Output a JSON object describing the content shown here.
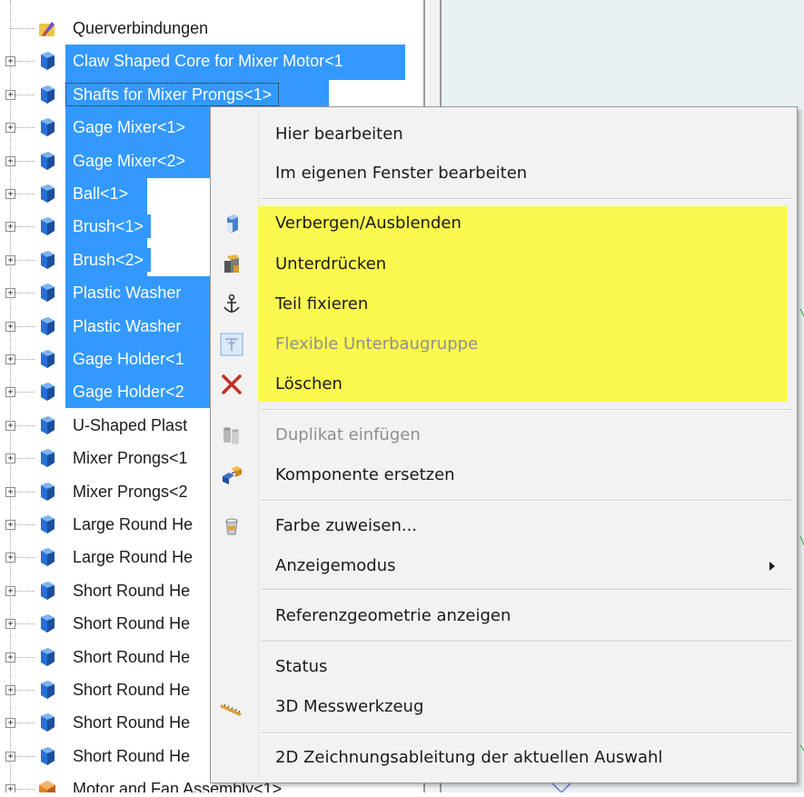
{
  "tree": {
    "items": [
      {
        "label": "Querverbindungen",
        "icon": "folder-connections-icon",
        "selected": false,
        "expandable": false
      },
      {
        "label": "Claw Shaped Core for Mixer Motor<1",
        "icon": "part-icon",
        "selected": true,
        "expandable": true
      },
      {
        "label": "Shafts for Mixer Prongs<1>",
        "icon": "part-icon",
        "selected": true,
        "focused": true,
        "expandable": true
      },
      {
        "label": "Gage Mixer<1>",
        "icon": "part-icon",
        "selected": true,
        "expandable": true
      },
      {
        "label": "Gage Mixer<2>",
        "icon": "part-icon",
        "selected": true,
        "expandable": true
      },
      {
        "label": "Ball<1>",
        "icon": "part-icon",
        "selected": true,
        "expandable": true
      },
      {
        "label": "Brush<1>",
        "icon": "part-icon",
        "selected": true,
        "expandable": true
      },
      {
        "label": "Brush<2>",
        "icon": "part-icon",
        "selected": true,
        "expandable": true
      },
      {
        "label": "Plastic Washer",
        "icon": "part-icon",
        "selected": true,
        "expandable": true
      },
      {
        "label": "Plastic Washer",
        "icon": "part-icon",
        "selected": true,
        "expandable": true
      },
      {
        "label": "Gage Holder<1",
        "icon": "part-icon",
        "selected": true,
        "expandable": true
      },
      {
        "label": "Gage Holder<2",
        "icon": "part-icon",
        "selected": true,
        "expandable": true
      },
      {
        "label": "U-Shaped Plast",
        "icon": "part-icon",
        "selected": false,
        "expandable": true
      },
      {
        "label": "Mixer Prongs<1",
        "icon": "part-icon",
        "selected": false,
        "expandable": true
      },
      {
        "label": "Mixer Prongs<2",
        "icon": "part-icon",
        "selected": false,
        "expandable": true
      },
      {
        "label": "Large Round He",
        "icon": "part-icon",
        "selected": false,
        "expandable": true
      },
      {
        "label": "Large Round He",
        "icon": "part-icon",
        "selected": false,
        "expandable": true
      },
      {
        "label": "Short Round He",
        "icon": "part-icon",
        "selected": false,
        "expandable": true
      },
      {
        "label": "Short Round He",
        "icon": "part-icon",
        "selected": false,
        "expandable": true
      },
      {
        "label": "Short Round He",
        "icon": "part-icon",
        "selected": false,
        "expandable": true
      },
      {
        "label": "Short Round He",
        "icon": "part-icon",
        "selected": false,
        "expandable": true
      },
      {
        "label": "Short Round He",
        "icon": "part-icon",
        "selected": false,
        "expandable": true
      },
      {
        "label": "Short Round He",
        "icon": "part-icon",
        "selected": false,
        "expandable": true
      },
      {
        "label": "Motor and Fan Assembly<1>",
        "icon": "assembly-icon",
        "selected": false,
        "expandable": true
      }
    ]
  },
  "menu": {
    "items": [
      {
        "label": "Hier bearbeiten",
        "icon": "",
        "disabled": false
      },
      {
        "label": "Im eigenen Fenster bearbeiten",
        "icon": "",
        "disabled": false
      },
      {
        "separator": true
      },
      {
        "label": "Verbergen/Ausblenden",
        "icon": "hide-component-icon",
        "disabled": false
      },
      {
        "label": "Unterdrücken",
        "icon": "suppress-icon",
        "disabled": false
      },
      {
        "label": "Teil fixieren",
        "icon": "anchor-icon",
        "disabled": false
      },
      {
        "label": "Flexible Unterbaugruppe",
        "icon": "flexible-subassembly-icon",
        "disabled": true
      },
      {
        "label": "Löschen",
        "icon": "delete-x-icon",
        "disabled": false
      },
      {
        "separator": true
      },
      {
        "label": "Duplikat einfügen",
        "icon": "duplicate-icon",
        "disabled": true
      },
      {
        "label": "Komponente ersetzen",
        "icon": "replace-component-icon",
        "disabled": false
      },
      {
        "separator": true
      },
      {
        "label": "Farbe zuweisen...",
        "icon": "paint-bucket-icon",
        "disabled": false
      },
      {
        "label": "Anzeigemodus",
        "icon": "",
        "disabled": false,
        "submenu": true
      },
      {
        "separator": true
      },
      {
        "label": "Referenzgeometrie anzeigen",
        "icon": "",
        "disabled": false
      },
      {
        "separator": true
      },
      {
        "label": "Status",
        "icon": "",
        "disabled": false
      },
      {
        "label": "3D Messwerkzeug",
        "icon": "measure-tape-icon",
        "disabled": false
      },
      {
        "separator": true
      },
      {
        "label": "2D Zeichnungsableitung der aktuellen Auswahl",
        "icon": "",
        "disabled": false
      }
    ]
  },
  "colors": {
    "selection": "#3399ff",
    "highlight": "#fbf94d",
    "menu_background": "#f2f2f2",
    "disabled_text": "#8f8f8f"
  }
}
